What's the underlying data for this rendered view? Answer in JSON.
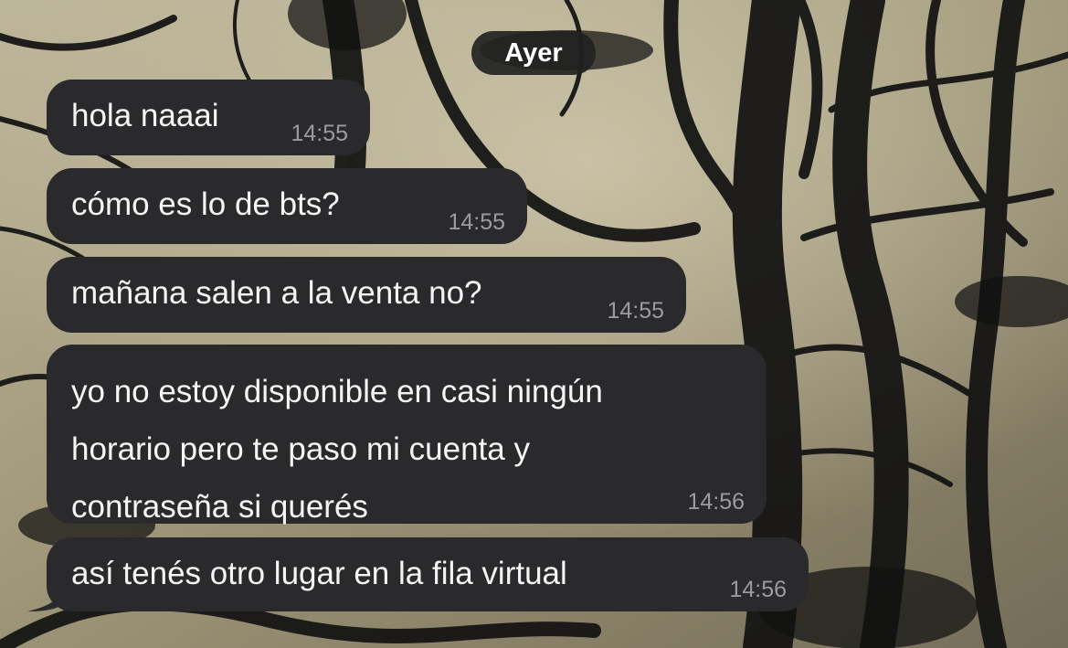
{
  "chat": {
    "date_label": "Ayer",
    "messages": [
      {
        "text": "hola naaai",
        "time": "14:55"
      },
      {
        "text": "cómo es lo de bts?",
        "time": "14:55"
      },
      {
        "text": "mañana salen a la venta no?",
        "time": "14:55"
      },
      {
        "lines": [
          "yo no estoy disponible en casi ningún",
          "horario pero te paso mi cuenta y",
          "contraseña si querés"
        ],
        "time": "14:56"
      },
      {
        "text": "así tenés otro lugar en la fila virtual",
        "time": "14:56"
      }
    ]
  },
  "colors": {
    "bubble": "#2a2a2c",
    "message_text": "#f5f5f5",
    "time_text": "#9b9b9f",
    "date_pill": "#222222"
  }
}
